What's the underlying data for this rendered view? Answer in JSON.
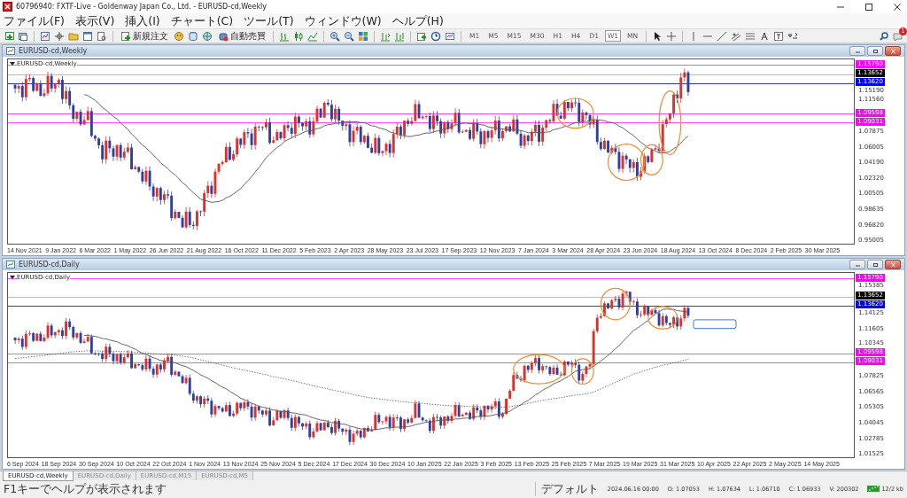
{
  "window": {
    "title": "60796940: FXTF-Live - Goldenway Japan Co., Ltd. - EURUSD-cd,Weekly"
  },
  "menu": [
    "ファイル(F)",
    "表示(V)",
    "挿入(I)",
    "チャート(C)",
    "ツール(T)",
    "ウィンドウ(W)",
    "ヘルプ(H)"
  ],
  "toolbar": {
    "new_order": "新規注文",
    "auto_trading": "自動売買",
    "timeframes": [
      {
        "label": "M1",
        "selected": false
      },
      {
        "label": "M5",
        "selected": false
      },
      {
        "label": "M15",
        "selected": false
      },
      {
        "label": "M30",
        "selected": false
      },
      {
        "label": "H1",
        "selected": false
      },
      {
        "label": "H4",
        "selected": false
      },
      {
        "label": "D1",
        "selected": false
      },
      {
        "label": "W1",
        "selected": true
      },
      {
        "label": "MN",
        "selected": false
      }
    ],
    "notification_count": "1"
  },
  "charts": [
    {
      "title": "EURUSD-cd,Weekly",
      "symbol_label": "EURUSD-cd,Weekly",
      "price_ticks": [
        "1.15190",
        "1.11560",
        "1.07875",
        "1.06005",
        "1.04190",
        "1.02320",
        "1.00505",
        "0.98635",
        "0.96820",
        "0.95005"
      ],
      "levels": [
        {
          "price": "1.15790",
          "color": "#ff00ff"
        },
        {
          "price": "1.13652",
          "color": "#000000"
        },
        {
          "price": "1.13620",
          "color": "#0000ff"
        },
        {
          "price": "1.09598",
          "color": "#ff00ff"
        },
        {
          "price": "1.09031",
          "color": "#ff00ff"
        }
      ],
      "dates": [
        "14 Nov 2021",
        "9 Jan 2022",
        "6 Mar 2022",
        "1 May 2022",
        "26 Jun 2022",
        "21 Aug 2022",
        "16 Oct 2022",
        "11 Dec 2022",
        "5 Feb 2023",
        "2 Apr 2023",
        "28 May 2023",
        "23 Jul 2023",
        "17 Sep 2023",
        "12 Nov 2023",
        "7 Jan 2024",
        "3 Mar 2024",
        "28 Apr 2024",
        "23 Jun 2024",
        "18 Aug 2024",
        "13 Oct 2024",
        "8 Dec 2024",
        "2 Feb 2025",
        "30 Mar 2025"
      ]
    },
    {
      "title": "EURUSD-cd,Daily",
      "symbol_label": "EURUSD-cd,Daily",
      "price_ticks": [
        "1.15385",
        "1.14125",
        "1.11605",
        "1.10345",
        "1.07825",
        "1.06565",
        "1.05305",
        "1.04045",
        "1.02785",
        "1.01525"
      ],
      "levels": [
        {
          "price": "1.15790",
          "color": "#ff00ff"
        },
        {
          "price": "1.13652",
          "color": "#000000"
        },
        {
          "price": "1.13620",
          "color": "#0000ff"
        },
        {
          "price": "1.09598",
          "color": "#ff00ff"
        },
        {
          "price": "1.09031",
          "color": "#ff00ff"
        }
      ],
      "dates": [
        "6 Sep 2024",
        "18 Sep 2024",
        "30 Sep 2024",
        "10 Oct 2024",
        "22 Oct 2024",
        "1 Nov 2024",
        "13 Nov 2024",
        "25 Nov 2024",
        "5 Dec 2024",
        "17 Dec 2024",
        "30 Dec 2024",
        "10 Jan 2025",
        "22 Jan 2025",
        "3 Feb 2025",
        "13 Feb 2025",
        "25 Feb 2025",
        "7 Mar 2025",
        "19 Mar 2025",
        "31 Mar 2025",
        "10 Apr 2025",
        "22 Apr 2025",
        "2 May 2025",
        "14 May 2025"
      ]
    }
  ],
  "tabs": [
    {
      "label": "EURUSD-cd,Weekly",
      "selected": true
    },
    {
      "label": "EURUSD-cd,Daily",
      "selected": false
    },
    {
      "label": "EURUSD-cd,M15",
      "selected": false
    },
    {
      "label": "EURUSD-cd,M5",
      "selected": false
    }
  ],
  "status_bar": {
    "help": "F1キーでヘルプが表示されます",
    "profile": "デフォルト",
    "time": "2024.06.16 00:00",
    "open": "O: 1.07053",
    "high": "H: 1.07634",
    "low": "L: 1.06710",
    "close": "C: 1.06933",
    "volume": "V: 200302",
    "traffic": "12/2 kb"
  }
}
